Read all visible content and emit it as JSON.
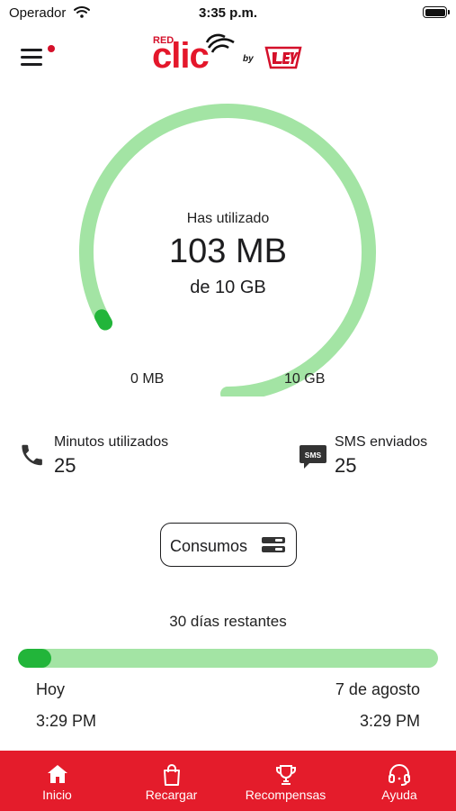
{
  "status_bar": {
    "carrier": "Operador",
    "time": "3:35 p.m."
  },
  "header": {
    "logo_red": "RED",
    "logo_clic": "clic",
    "logo_by": "by",
    "menu_notification_color": "#d4102a"
  },
  "data_usage": {
    "title": "Has utilizado",
    "used": "103 MB",
    "total": "de 10 GB",
    "min_label": "0 MB",
    "max_label": "10 GB",
    "used_fraction": 0.01
  },
  "minutes": {
    "title": "Minutos utilizados",
    "value": "25",
    "icon": "phone-icon"
  },
  "sms": {
    "title": "SMS enviados",
    "value": "25",
    "icon": "sms-icon",
    "icon_text": "SMS"
  },
  "consumos_button": {
    "label": "Consumos",
    "icon": "consumption-list-icon"
  },
  "period": {
    "remaining": "30 días restantes",
    "elapsed_fraction": 0.08,
    "start_date": "Hoy",
    "start_time": "3:29 PM",
    "end_date": "7 de agosto",
    "end_time": "3:29 PM"
  },
  "tabs": [
    {
      "label": "Inicio",
      "icon": "home-icon"
    },
    {
      "label": "Recargar",
      "icon": "shopping-bag-icon"
    },
    {
      "label": "Recompensas",
      "icon": "trophy-icon"
    },
    {
      "label": "Ayuda",
      "icon": "headset-icon"
    }
  ],
  "colors": {
    "brand_red": "#e41c2b",
    "progress_track": "#a3e4a4",
    "progress_fill": "#22b53a"
  }
}
